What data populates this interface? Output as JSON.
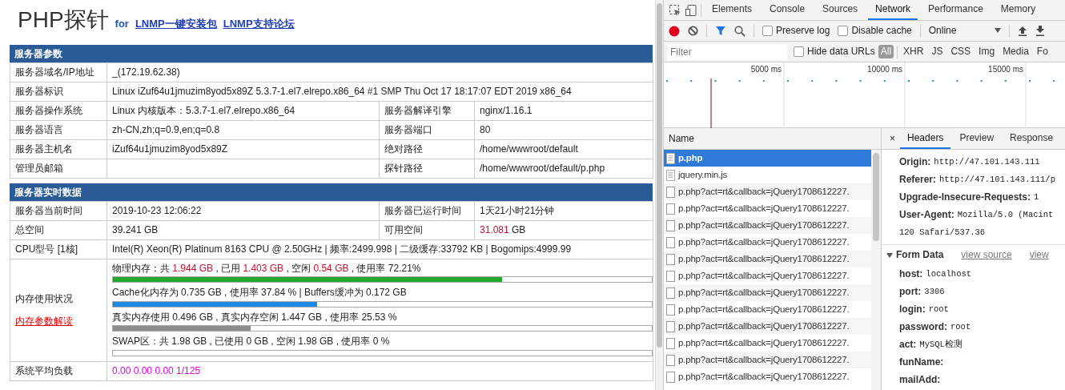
{
  "probe": {
    "title": "PHP探针",
    "tagline": "for",
    "links": [
      "LNMP一键安装包",
      "LNMP支持论坛"
    ],
    "sections": [
      {
        "title": "服务器参数",
        "rows": [
          {
            "cells": [
              {
                "text": "服务器域名/IP地址"
              },
              {
                "text": "_(172.19.62.38)",
                "colspan": 3
              }
            ]
          },
          {
            "cells": [
              {
                "text": "服务器标识"
              },
              {
                "text": "Linux iZuf64u1jmuzim8yod5x89Z 5.3.7-1.el7.elrepo.x86_64 #1 SMP Thu Oct 17 18:17:07 EDT 2019 x86_64",
                "colspan": 3
              }
            ]
          },
          {
            "cells": [
              {
                "text": "服务器操作系统"
              },
              {
                "text": "Linux  内核版本：5.3.7-1.el7.elrepo.x86_64"
              },
              {
                "text": "服务器解译引擎"
              },
              {
                "text": "nginx/1.16.1"
              }
            ]
          },
          {
            "cells": [
              {
                "text": "服务器语言"
              },
              {
                "text": "zh-CN,zh;q=0.9,en;q=0.8"
              },
              {
                "text": "服务器端口"
              },
              {
                "text": "80"
              }
            ]
          },
          {
            "cells": [
              {
                "text": "服务器主机名"
              },
              {
                "text": "iZuf64u1jmuzim8yod5x89Z"
              },
              {
                "text": "绝对路径"
              },
              {
                "text": "/home/wwwroot/default"
              }
            ]
          },
          {
            "cells": [
              {
                "text": "管理员邮箱"
              },
              {},
              {
                "text": "探针路径"
              },
              {
                "text": "/home/wwwroot/default/p.php"
              }
            ]
          }
        ]
      },
      {
        "title": "服务器实时数据",
        "rows": [
          {
            "cells": [
              {
                "text": "服务器当前时间"
              },
              {
                "text": "2019-10-23 12:06:22"
              },
              {
                "text": "服务器已运行时间"
              },
              {
                "text": "1天21小时21分钟"
              }
            ]
          },
          {
            "cells": [
              {
                "text": "总空间"
              },
              {
                "text": "39.241 GB"
              },
              {
                "text": "可用空间"
              },
              {
                "parts": [
                  {
                    "text": "31.081",
                    "highlight": true
                  },
                  {
                    "text": " GB",
                    "highlight": false
                  }
                ]
              }
            ]
          },
          {
            "cells": [
              {
                "text": "CPU型号 [1核]"
              },
              {
                "text": "Intel(R) Xeon(R) Platinum 8163 CPU @ 2.50GHz | 频率:2499.998 | 二级缓存:33792 KB | Bogomips:4999.99",
                "colspan": 3
              }
            ]
          },
          {
            "kind": "memory",
            "label": "内存使用状况",
            "link": "内存参数解读",
            "items": [
              {
                "parts": [
                  {
                    "text": "物理内存：共 ",
                    "highlight": false
                  },
                  {
                    "text": "1.944 GB",
                    "highlight": true
                  },
                  {
                    "text": " , 已用 ",
                    "highlight": false
                  },
                  {
                    "text": "1.403 GB",
                    "highlight": true
                  },
                  {
                    "text": " , 空闲 ",
                    "highlight": false
                  },
                  {
                    "text": "0.54 GB",
                    "highlight": true
                  },
                  {
                    "text": " , 使用率 72.21%",
                    "highlight": false
                  }
                ],
                "level": 0.7221,
                "color": "#22a82c"
              },
              {
                "text": "Cache化内存为 0.735 GB , 使用率 37.84 % | Buffers缓冲为 0.172 GB",
                "level": 0.3784,
                "color": "#1e88e5"
              },
              {
                "text": "真实内存使用 0.496 GB , 真实内存空闲 1.447 GB , 使用率 25.53 %",
                "level": 0.2553,
                "color": "#8c8c8c"
              },
              {
                "text": "SWAP区：共 1.98 GB , 已使用 0 GB , 空闲 1.98 GB , 使用率 0 %"
              }
            ]
          },
          {
            "kind": "load",
            "cells": [
              {
                "text": "系统平均负载"
              },
              {
                "text": "0.00 0.00 0.00 1/125",
                "colspan": 3
              }
            ]
          }
        ]
      }
    ]
  },
  "devtools": {
    "main_tabs": [
      {
        "label": "Elements",
        "selected": false
      },
      {
        "label": "Console",
        "selected": false
      },
      {
        "label": "Sources",
        "selected": false
      },
      {
        "label": "Network",
        "selected": true
      },
      {
        "label": "Performance",
        "selected": false
      },
      {
        "label": "Memory",
        "selected": false
      }
    ],
    "recording": true,
    "filter_on": true,
    "preserve_log": {
      "label": "Preserve log",
      "checked": false
    },
    "disable_cache": {
      "label": "Disable cache",
      "checked": false
    },
    "throttle": "Online",
    "filter": {
      "placeholder": "Filter"
    },
    "hide_data_urls": {
      "label": "Hide data URLs",
      "checked": false
    },
    "types": [
      {
        "label": "All",
        "selected": true
      },
      {
        "label": "XHR",
        "selected": false
      },
      {
        "label": "JS",
        "selected": false
      },
      {
        "label": "CSS",
        "selected": false
      },
      {
        "label": "Img",
        "selected": false
      },
      {
        "label": "Media",
        "selected": false
      },
      {
        "label": "Fo",
        "selected": false
      }
    ],
    "timeline": {
      "ticks": [
        "5000 ms",
        "10000 ms",
        "15000 ms"
      ]
    },
    "requests": {
      "column": "Name",
      "items": [
        {
          "name": "p.php",
          "kind": "document",
          "selected": true
        },
        {
          "name": "jquery.min.js",
          "kind": "document",
          "selected": false
        },
        {
          "name": "p.php?act=rt&callback=jQuery1708612227.",
          "kind": "xhr",
          "selected": false
        },
        {
          "name": "p.php?act=rt&callback=jQuery1708612227.",
          "kind": "xhr",
          "selected": false
        },
        {
          "name": "p.php?act=rt&callback=jQuery1708612227.",
          "kind": "xhr",
          "selected": false
        },
        {
          "name": "p.php?act=rt&callback=jQuery1708612227.",
          "kind": "xhr",
          "selected": false
        },
        {
          "name": "p.php?act=rt&callback=jQuery1708612227.",
          "kind": "xhr",
          "selected": false
        },
        {
          "name": "p.php?act=rt&callback=jQuery1708612227.",
          "kind": "xhr",
          "selected": false
        },
        {
          "name": "p.php?act=rt&callback=jQuery1708612227.",
          "kind": "xhr",
          "selected": false
        },
        {
          "name": "p.php?act=rt&callback=jQuery1708612227.",
          "kind": "xhr",
          "selected": false
        },
        {
          "name": "p.php?act=rt&callback=jQuery1708612227.",
          "kind": "xhr",
          "selected": false
        },
        {
          "name": "p.php?act=rt&callback=jQuery1708612227.",
          "kind": "xhr",
          "selected": false
        },
        {
          "name": "p.php?act=rt&callback=jQuery1708612227.",
          "kind": "xhr",
          "selected": false
        },
        {
          "name": "p.php?act=rt&callback=jQuery1708612227.",
          "kind": "xhr",
          "selected": false
        }
      ]
    },
    "details": {
      "close": "×",
      "tabs": [
        {
          "label": "Headers",
          "selected": true
        },
        {
          "label": "Preview",
          "selected": false
        },
        {
          "label": "Response",
          "selected": false
        }
      ],
      "headers": [
        {
          "name": "Origin:",
          "value": "http://47.101.143.111"
        },
        {
          "name": "Referer:",
          "value": "http://47.101.143.111/p"
        },
        {
          "name": "Upgrade-Insecure-Requests:",
          "value": "1"
        },
        {
          "name": "User-Agent:",
          "value": "Mozilla/5.0 (Macint"
        }
      ],
      "header_continuation": "120 Safari/537.36",
      "form_data": {
        "title": "Form Data",
        "expanded": true,
        "links": [
          "view source",
          "view"
        ],
        "fields": [
          {
            "name": "host:",
            "value": "localhost"
          },
          {
            "name": "port:",
            "value": "3306"
          },
          {
            "name": "login:",
            "value": "root"
          },
          {
            "name": "password:",
            "value": "root"
          },
          {
            "name": "act:",
            "value": "MySQL检测"
          },
          {
            "name": "funName:"
          },
          {
            "name": "mailAdd:"
          }
        ]
      }
    }
  }
}
